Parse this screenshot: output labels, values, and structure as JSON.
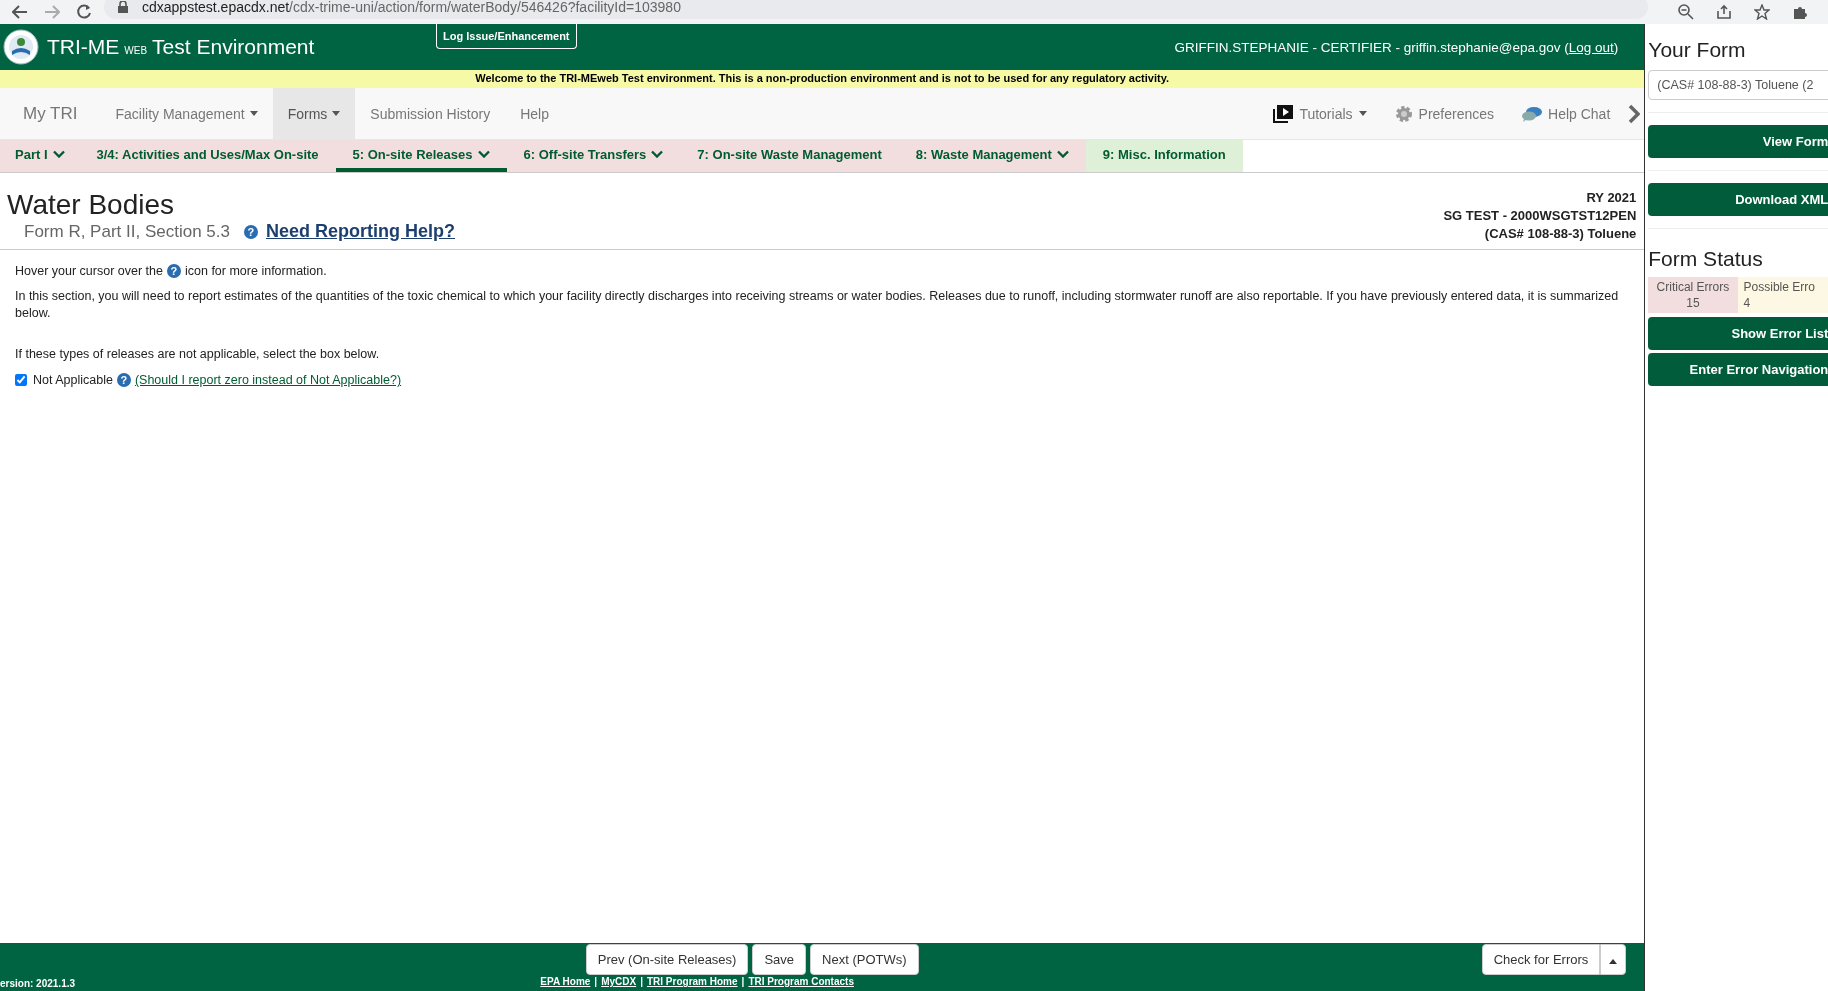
{
  "browser": {
    "url_host": "cdxappstest.epacdx.net",
    "url_path": "/cdx-trime-uni/action/form/waterBody/546426?facilityId=103980"
  },
  "header": {
    "app_name": "TRI-ME",
    "app_suffix": "WEB",
    "app_env": "Test Environment",
    "log_issue": "Log Issue/Enhancement",
    "user": "GRIFFIN.STEPHANIE - CERTIFIER - griffin.stephanie@epa.gov (",
    "logout": "Log out",
    "user_end": ")"
  },
  "banner": "Welcome to the TRI-MEweb Test environment. This is a non-production environment and is not to be used for any regulatory activity.",
  "nav": {
    "brand": "My TRI",
    "items": [
      {
        "label": "Facility Management",
        "caret": true,
        "selected": false
      },
      {
        "label": "Forms",
        "caret": true,
        "selected": true
      },
      {
        "label": "Submission History",
        "caret": false,
        "selected": false
      },
      {
        "label": "Help",
        "caret": false,
        "selected": false
      }
    ],
    "right_items": [
      {
        "label": "Tutorials",
        "kind": "tutorials",
        "caret": true
      },
      {
        "label": "Preferences",
        "kind": "preferences",
        "caret": false
      },
      {
        "label": "Help Chat",
        "kind": "chat",
        "caret": false
      }
    ]
  },
  "tabs": [
    {
      "label": "Part I",
      "caret": true,
      "selected": false,
      "color": "#f2dede"
    },
    {
      "label": "3/4: Activities and Uses/Max On-site",
      "caret": false,
      "selected": false,
      "color": "#f2dede"
    },
    {
      "label": "5: On-site Releases",
      "caret": true,
      "selected": true,
      "color": "#f2dede"
    },
    {
      "label": "6: Off-site Transfers",
      "caret": true,
      "selected": false,
      "color": "#f2dede"
    },
    {
      "label": "7: On-site Waste Management",
      "caret": false,
      "selected": false,
      "color": "#f2dede"
    },
    {
      "label": "8: Waste Management",
      "caret": true,
      "selected": false,
      "color": "#f2dede"
    },
    {
      "label": "9: Misc. Information",
      "caret": false,
      "selected": false,
      "color": "#dff0d8"
    }
  ],
  "page": {
    "title": "Water Bodies",
    "subtitle": "Form R, Part II, Section 5.3",
    "help_icon": "?",
    "help_link": "Need Reporting Help?",
    "ry": "RY 2021",
    "facility": "SG TEST - 2000WSGTST12PEN",
    "chemical": "(CAS# 108-88-3) Toluene"
  },
  "content": {
    "hover_before": "Hover your cursor over the",
    "help_icon": "?",
    "hover_after": "icon for more information.",
    "intro": "In this section, you will need to report estimates of the quantities of the toxic chemical to which your facility directly discharges into receiving streams or water bodies. Releases due to runoff, including stormwater runoff are also reportable. If you have previously entered data, it is summarized below.",
    "na_note": "If these types of releases are not applicable, select the box below.",
    "not_applicable": {
      "label": "Not Applicable",
      "help_icon": "?",
      "checked": true,
      "link": "(Should I report zero instead of Not Applicable?)"
    }
  },
  "footer": {
    "buttons": [
      "Prev (On-site Releases)",
      "Save",
      "Next (POTWs)"
    ],
    "check": "Check for Errors",
    "version": "ersion: 2021.1.3",
    "links": [
      {
        "label": "EPA Home"
      },
      {
        "separator": "|",
        "label": "MyCDX"
      },
      {
        "separator": "|",
        "label": "TRI Program Home"
      },
      {
        "separator": "|",
        "label": "TRI Program Contacts"
      }
    ]
  },
  "sidebar": {
    "title": "Your Form",
    "form_select": "(CAS# 108-88-3) Toluene (2",
    "view_form": "View Form",
    "download": "Download XML",
    "status_title": "Form Status",
    "errors": [
      {
        "label": "Critical Errors",
        "count": "15",
        "kind": "critical"
      },
      {
        "label": "Possible Erro",
        "count": "4",
        "kind": "possible"
      }
    ],
    "buttons": [
      "Show Error List",
      "Enter Error Navigation"
    ]
  }
}
